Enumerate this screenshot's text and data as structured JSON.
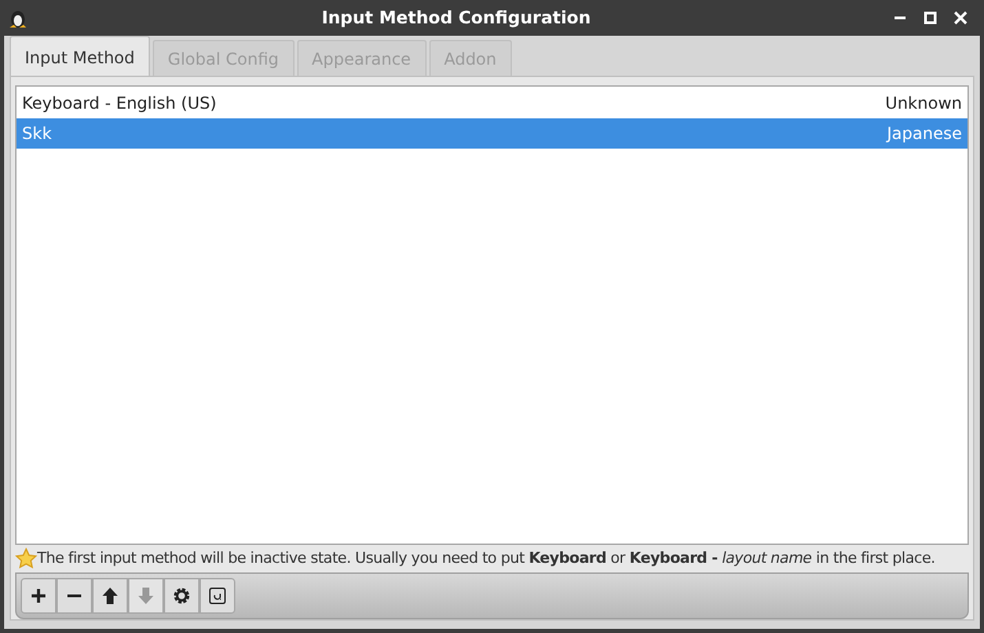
{
  "window": {
    "title": "Input Method Configuration"
  },
  "tabs": [
    {
      "label": "Input Method",
      "selected": true
    },
    {
      "label": "Global Config",
      "selected": false
    },
    {
      "label": "Appearance",
      "selected": false
    },
    {
      "label": "Addon",
      "selected": false
    }
  ],
  "input_methods": [
    {
      "name": "Keyboard - English (US)",
      "language": "Unknown",
      "selected": false
    },
    {
      "name": "Skk",
      "language": "Japanese",
      "selected": true
    }
  ],
  "note": "The first input method will be inactive state. Usually you need to put **Keyboard** or **Keyboard -** *layout name* in the first place.",
  "toolbar": [
    {
      "kind": "add",
      "disabled": false
    },
    {
      "kind": "remove",
      "disabled": false
    },
    {
      "kind": "up",
      "disabled": false
    },
    {
      "kind": "down",
      "disabled": true
    },
    {
      "kind": "settings",
      "disabled": false
    },
    {
      "kind": "layout",
      "disabled": false
    }
  ]
}
